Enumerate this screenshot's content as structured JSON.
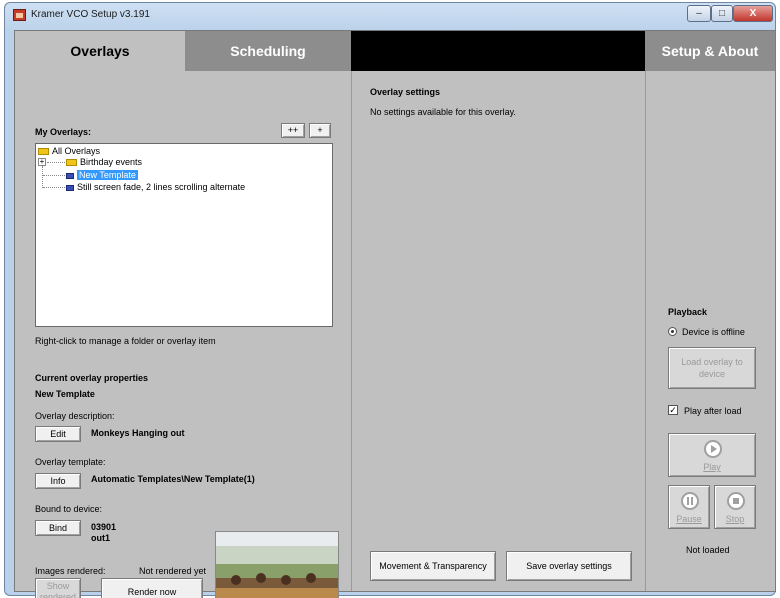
{
  "window": {
    "title": "Kramer VCO Setup v3.191",
    "minimize": "–",
    "maximize": "□",
    "close": "X"
  },
  "tabs": {
    "overlays": "Overlays",
    "scheduling": "Scheduling",
    "setup": "Setup & About"
  },
  "left": {
    "my_overlays": "My Overlays:",
    "btn_expand": "++",
    "btn_add": "+",
    "tree": {
      "root": "All Overlays",
      "expander": "+",
      "item1": "Birthday events",
      "item2": "New Template",
      "item3": "Still screen fade, 2 lines scrolling alternate"
    },
    "hint": "Right-click to manage a folder or overlay item",
    "props_header": "Current overlay properties",
    "props_name": "New Template",
    "desc_label": "Overlay description:",
    "edit_btn": "Edit",
    "desc_value": "Monkeys Hanging out",
    "template_label": "Overlay template:",
    "info_btn": "Info",
    "template_value": "Automatic Templates\\New Template(1)",
    "bound_label": "Bound to device:",
    "bind_btn": "Bind",
    "device_id": "03901",
    "device_out": "out1",
    "images_label": "Images rendered:",
    "images_status": "Not rendered yet",
    "show_rendered_btn": "Show rendered",
    "render_now_btn": "Render now"
  },
  "middle": {
    "header": "Overlay settings",
    "text": "No settings available for this overlay.",
    "movement_btn": "Movement & Transparency",
    "save_btn": "Save overlay settings"
  },
  "right": {
    "playback": "Playback",
    "device_status": "Device is offline",
    "load_btn": "Load overlay to device",
    "play_after_label": "Play after load",
    "play_after_checked": true,
    "check_mark": "✓",
    "play_btn": "Play",
    "pause_btn": "Pause",
    "stop_btn": "Stop",
    "status": "Not loaded"
  },
  "colors": {
    "panel": "#c0c0c0",
    "tab_active": "#c0c0c0",
    "tab_inactive": "#8d8d8d",
    "tabbar": "#000000",
    "selection": "#3399ff"
  }
}
